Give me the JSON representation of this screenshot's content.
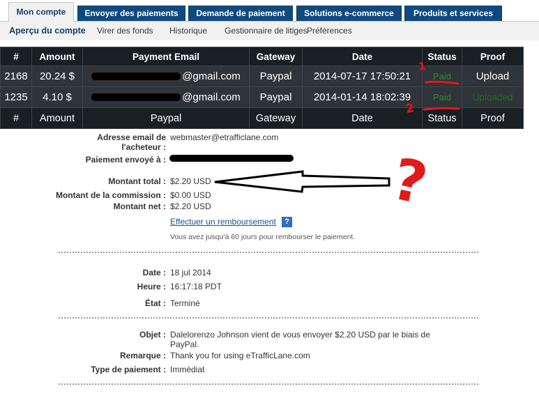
{
  "top_tabs": [
    "Mon compte",
    "Envoyer des paiements",
    "Demande de paiement",
    "Solutions e-commerce",
    "Produits et services"
  ],
  "sub_nav": [
    "Aperçu du compte",
    "Virer des fonds",
    "Historique",
    "Gestionnaire de litiges",
    "Préférences"
  ],
  "table": {
    "headers": [
      "#",
      "Amount",
      "Payment Email",
      "Gateway",
      "Date",
      "Status",
      "Proof"
    ],
    "rows": [
      {
        "id": "2168",
        "amount": "20.24 $",
        "email_suffix": "@gmail.com",
        "gateway": "Paypal",
        "date": "2014-07-17 17:50:21",
        "status": "Paid",
        "proof": "Upload"
      },
      {
        "id": "1235",
        "amount": "4.10 $",
        "email_suffix": "@gmail.com",
        "gateway": "Paypal",
        "date": "2014-01-14 18:02:39",
        "status": "Paid",
        "proof": "Uploaded"
      }
    ],
    "footer": [
      "#",
      "Amount",
      "Paypal",
      "Gateway",
      "Date",
      "Status",
      "Proof"
    ]
  },
  "annotations": {
    "mark1": "1",
    "mark2": "2",
    "question": "?",
    "color": "#e11a1a"
  },
  "details": {
    "buyer_email_label": "Adresse email de l'acheteur :",
    "buyer_email": "webmaster@etrafficlane.com",
    "sent_to_label": "Paiement envoyé à :",
    "total_label": "Montant total :",
    "total": "$2.20 USD",
    "fee_label": "Montant de la commission :",
    "fee": "$0.00 USD",
    "net_label": "Montant net :",
    "net": "$2.20 USD",
    "refund_link": "Effectuer un remboursement",
    "help_icon": "?",
    "refund_note": "Vous avez jusqu'à 60 jours pour rembourser le paiement.",
    "date_label": "Date :",
    "date": "18 jul 2014",
    "time_label": "Heure :",
    "time": "16:17:18 PDT",
    "state_label": "État :",
    "state": "Terminé",
    "subject_label": "Objet :",
    "subject_line1": "Dalelorenzo Johnson vient de vous envoyer $2.20 USD par le biais de",
    "subject_line2": "PayPal.",
    "remark_label": "Remarque :",
    "remark": "Thank you for using eTrafficLane.com",
    "type_label": "Type de paiement :",
    "type": "Immédiat"
  },
  "colors": {
    "tab_bg": "#0f4a7f",
    "table_bg": "#1a1f24",
    "paid": "#2e8b2e",
    "link": "#1c4f91"
  }
}
